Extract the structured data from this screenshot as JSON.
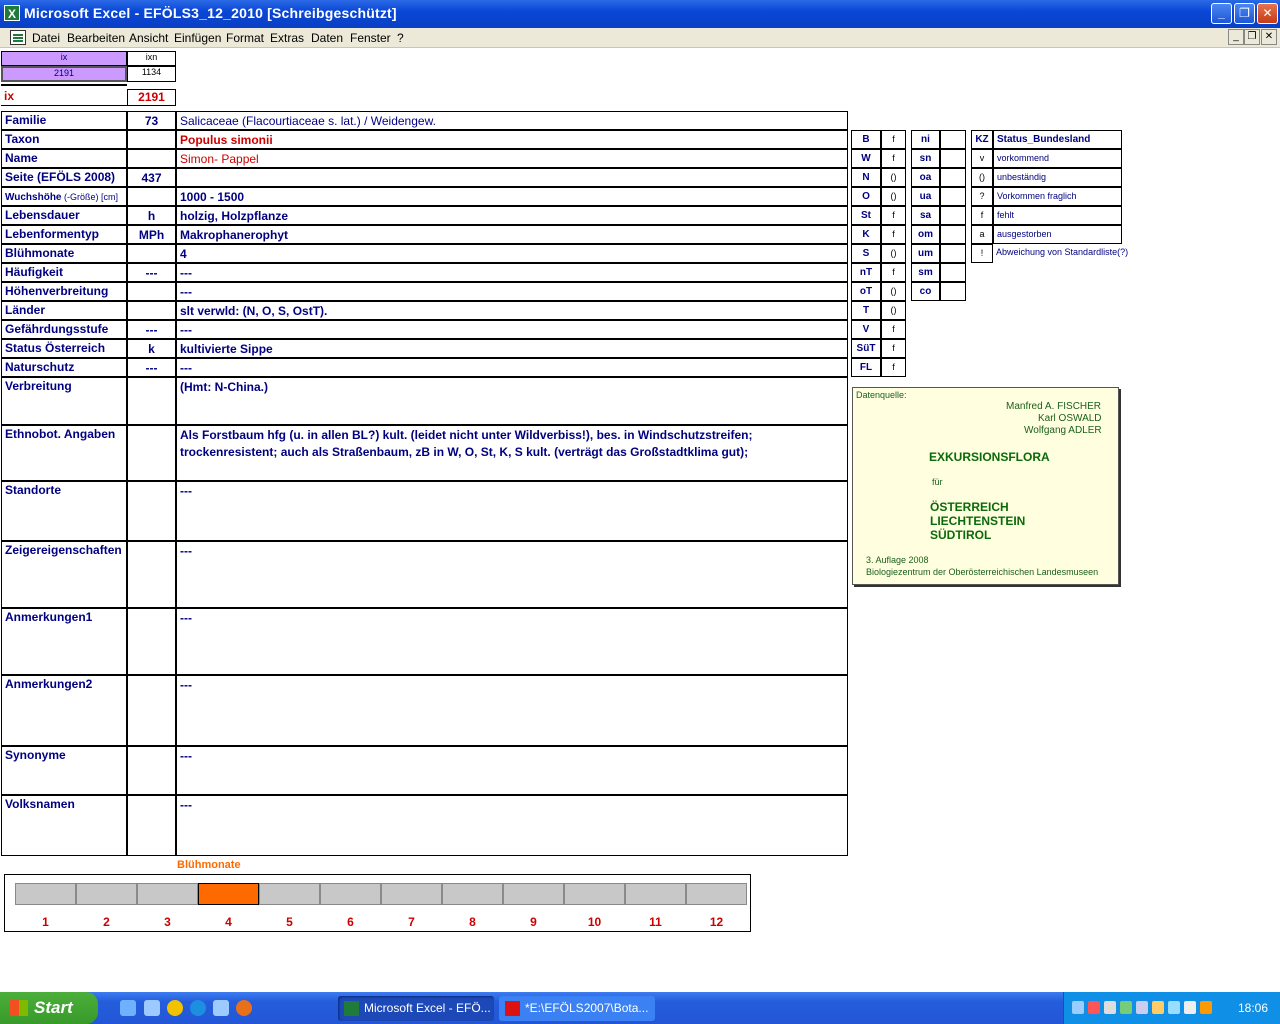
{
  "window": {
    "app_icon": "X",
    "title": "Microsoft Excel - EFÖLS3_12_2010  [Schreibgeschützt]",
    "btn_min": "_",
    "btn_max": "❐",
    "btn_close": "✕"
  },
  "menu": [
    "Datei",
    "Bearbeiten",
    "Ansicht",
    "Einfügen",
    "Format",
    "Extras",
    "Daten",
    "Fenster",
    "?"
  ],
  "mdi": {
    "min": "_",
    "restore": "❐",
    "close": "✕"
  },
  "top": {
    "ix_header": "ix",
    "ixn_header": "ixn",
    "ix_value": "2191",
    "ixn_value": "1134",
    "ix_label": "ix",
    "ix_big": "2191"
  },
  "rows": [
    {
      "label": "Familie",
      "code": "73",
      "value": "Salicaceae (Flacourtiaceae s. lat.)  /  Weidengew."
    },
    {
      "label": "Taxon",
      "code": "",
      "value": "Populus simonii"
    },
    {
      "label": "Name",
      "code": "",
      "value": "Simon- Pappel"
    },
    {
      "label": "Seite (EFÖLS 2008)",
      "code": "437",
      "value": ""
    },
    {
      "label": "Wuchshöhe",
      "label_small": " (-Größe) [cm]",
      "code": "",
      "value": "1000 - 1500"
    },
    {
      "label": "Lebensdauer",
      "code": "h",
      "value": "holzig, Holzpflanze"
    },
    {
      "label": "Lebenformentyp",
      "code": "MPh",
      "value": "Makrophanerophyt"
    },
    {
      "label": "Blühmonate",
      "code": "",
      "value": "4"
    },
    {
      "label": "Häufigkeit",
      "code": "---",
      "value": "---"
    },
    {
      "label": "Höhenverbreitung",
      "code": "",
      "value": "---"
    },
    {
      "label": "Länder",
      "code": "",
      "value": "slt verwld: (N, O, S, OstT)."
    },
    {
      "label": "Gefährdungsstufe",
      "code": "---",
      "value": "  ---"
    },
    {
      "label": "Status Österreich",
      "code": "k",
      "value": "kultivierte Sippe"
    },
    {
      "label": "Naturschutz",
      "code": "---",
      "value": "---"
    }
  ],
  "big_rows": [
    {
      "label": "Verbreitung",
      "value": "(Hmt: N-China.)"
    },
    {
      "label": "Ethnobot. Angaben",
      "value": "Als Forstbaum hfg (u. in allen BL?) kult. (leidet nicht unter Wildverbiss!), bes. in Windschutzstreifen; trockenresistent; auch als Straßenbaum, zB in W, O, St, K, S kult. (verträgt das Großstadtklima gut);"
    },
    {
      "label": "Standorte",
      "value": "---"
    },
    {
      "label": "Zeigereigenschaften",
      "value": "---"
    },
    {
      "label": "Anmerkungen1",
      "value": "---"
    },
    {
      "label": "Anmerkungen2",
      "value": "---"
    },
    {
      "label": "Synonyme",
      "value": "---"
    },
    {
      "label": "Volksnamen",
      "value": "---"
    }
  ],
  "states": [
    {
      "code": "B",
      "val": "f"
    },
    {
      "code": "W",
      "val": "f"
    },
    {
      "code": "N",
      "val": "()"
    },
    {
      "code": "O",
      "val": "()"
    },
    {
      "code": "St",
      "val": "f"
    },
    {
      "code": "K",
      "val": "f"
    },
    {
      "code": "S",
      "val": "()"
    },
    {
      "code": "nT",
      "val": "f"
    },
    {
      "code": "oT",
      "val": "()"
    },
    {
      "code": "T",
      "val": "()"
    },
    {
      "code": "V",
      "val": "f"
    },
    {
      "code": "SüT",
      "val": "f"
    },
    {
      "code": "FL",
      "val": "f"
    }
  ],
  "regions": [
    {
      "code": "ni",
      "val": ""
    },
    {
      "code": "sn",
      "val": ""
    },
    {
      "code": "oa",
      "val": ""
    },
    {
      "code": "ua",
      "val": ""
    },
    {
      "code": "sa",
      "val": ""
    },
    {
      "code": "om",
      "val": ""
    },
    {
      "code": "um",
      "val": ""
    },
    {
      "code": "sm",
      "val": ""
    },
    {
      "code": "co",
      "val": ""
    }
  ],
  "legend": {
    "kz": "KZ",
    "title": "Status_Bundesland",
    "items": [
      {
        "k": "v",
        "t": "vorkommend"
      },
      {
        "k": "()",
        "t": "unbeständig"
      },
      {
        "k": "?",
        "t": "Vorkommen fraglich"
      },
      {
        "k": "f",
        "t": "fehlt"
      },
      {
        "k": "a",
        "t": "ausgestorben"
      },
      {
        "k": "!",
        "t": "Abweichung von Standardliste(?)"
      }
    ]
  },
  "source": {
    "label": "Datenquelle:",
    "author1": "Manfred A. FISCHER",
    "author2": "Karl OSWALD",
    "author3": "Wolfgang ADLER",
    "title": "EXKURSIONSFLORA",
    "fuer": "für",
    "c1": "ÖSTERREICH",
    "c2": "LIECHTENSTEIN",
    "c3": "SÜDTIROL",
    "edition": "3. Auflage 2008",
    "publisher": "Biologiezentrum der Oberösterreichischen Landesmuseen"
  },
  "bloom": {
    "title": "Blühmonate",
    "months": [
      "1",
      "2",
      "3",
      "4",
      "5",
      "6",
      "7",
      "8",
      "9",
      "10",
      "11",
      "12"
    ],
    "active_months": [
      4
    ],
    "colors": {
      "active": "#ff6a00",
      "inactive": "#c8c8c8"
    }
  },
  "taskbar": {
    "start": "Start",
    "task1": "Microsoft Excel - EFÖ...",
    "task2": "*E:\\EFÖLS2007\\Bota...",
    "clock": "18:06"
  },
  "colors": {
    "label": "#000080",
    "accent_red": "#cc0000",
    "header_purple": "#cc99ff",
    "source_bg": "#ffffe0"
  }
}
